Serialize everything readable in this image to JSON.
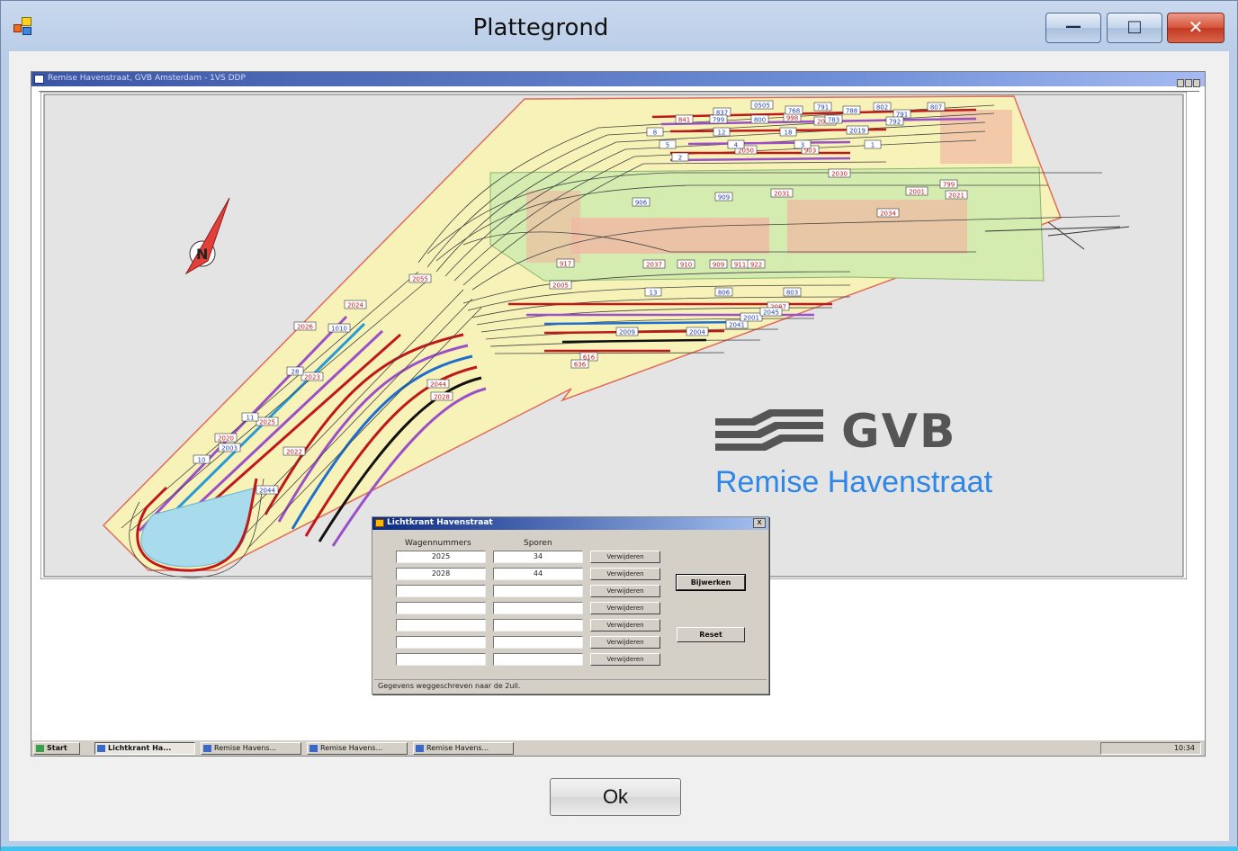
{
  "window": {
    "title": "Plattegrond",
    "minimize_glyph": "—",
    "maximize_glyph": "□",
    "close_glyph": "✕",
    "ok_label": "Ok"
  },
  "inner_window": {
    "title": "Remise Havenstraat, GVB Amsterdam - 1VS DDP"
  },
  "plan": {
    "brand": "GVB",
    "subtitle": "Remise Havenstraat",
    "track_labels_red": [
      "2055",
      "2024",
      "2026",
      "2023",
      "2025",
      "2020",
      "2022",
      "2050",
      "903",
      "2031",
      "2021",
      "2030",
      "2001",
      "917",
      "2037",
      "910",
      "909",
      "911",
      "922",
      "2005",
      "2087",
      "2044",
      "616",
      "636",
      "2028",
      "2034",
      "841",
      "799",
      "998",
      "2021"
    ],
    "track_labels_blue": [
      "837",
      "0505",
      "768",
      "791",
      "788",
      "802",
      "791",
      "807",
      "799",
      "800",
      "783",
      "792",
      "8",
      "12",
      "18",
      "2019",
      "5",
      "4",
      "3",
      "1",
      "2",
      "906",
      "909",
      "13",
      "806",
      "803",
      "2009",
      "2004",
      "2041",
      "2001",
      "2045",
      "11",
      "10",
      "2003",
      "2044",
      "28",
      "1010"
    ]
  },
  "dialog": {
    "title": "Lichtkrant Havenstraat",
    "col_wagen": "Wagennummers",
    "col_sporen": "Sporen",
    "rows": [
      {
        "wagen": "2025",
        "spoor": "34"
      },
      {
        "wagen": "2028",
        "spoor": "44"
      },
      {
        "wagen": "",
        "spoor": ""
      },
      {
        "wagen": "",
        "spoor": ""
      },
      {
        "wagen": "",
        "spoor": ""
      },
      {
        "wagen": "",
        "spoor": ""
      },
      {
        "wagen": "",
        "spoor": ""
      }
    ],
    "remove_label": "Verwijderen",
    "update_label": "Bijwerken",
    "reset_label": "Reset",
    "status": "Gegevens weggeschreven naar de 2uil."
  },
  "taskbar": {
    "start": "Start",
    "items": [
      "Lichtkrant Ha...",
      "Remise Havens...",
      "Remise Havens...",
      "Remise Havens..."
    ],
    "clock": "10:34"
  },
  "colors": {
    "accent_blue": "#2e86e6",
    "site_yellow": "#f7f3b8",
    "site_green": "#d4ecb0",
    "track_red": "#c0181a",
    "water": "#a8dcec"
  }
}
